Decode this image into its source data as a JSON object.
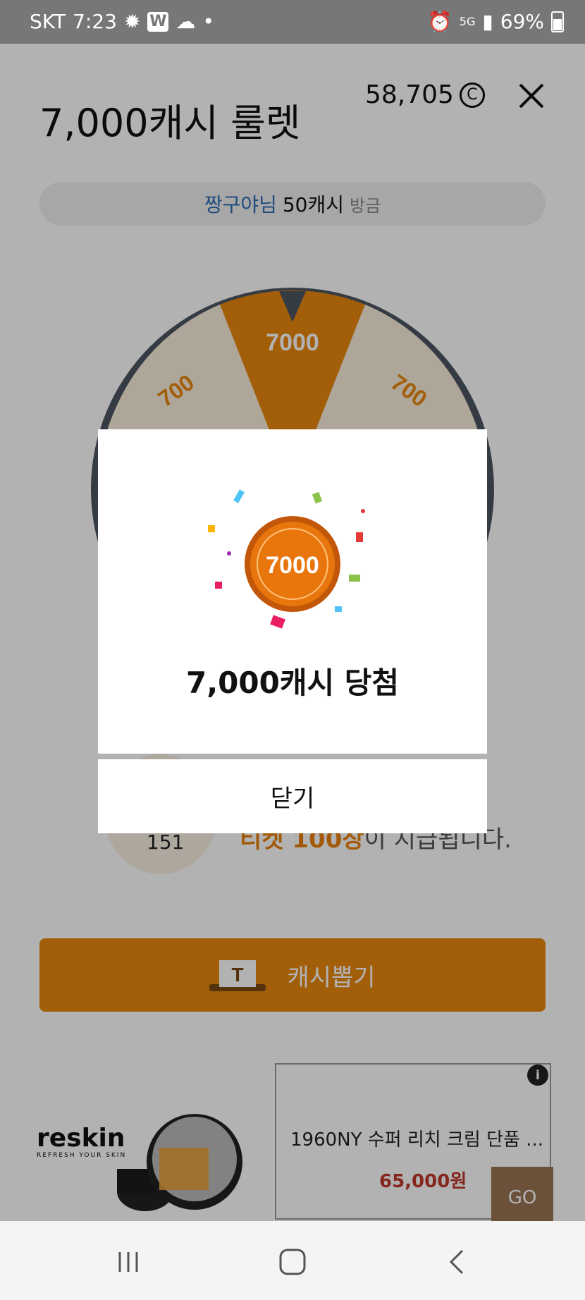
{
  "status_bar": {
    "carrier": "SKT",
    "time": "7:23",
    "network": "5G",
    "battery": "69%"
  },
  "header": {
    "title": "7,000캐시 룰렛",
    "cash_balance": "58,705",
    "cash_symbol": "C"
  },
  "notice": {
    "user": "짱구야님",
    "amount": "50캐시",
    "time": "방금"
  },
  "wheel": {
    "segments": [
      "700",
      "7000",
      "700"
    ],
    "accent_color": "#e8870d"
  },
  "tickets": {
    "count": "151",
    "text_highlight": "티켓 100장",
    "text_rest": "이 지급됩니다."
  },
  "draw_button": {
    "label": "캐시뽑기"
  },
  "ad": {
    "brand": "reskin",
    "brand_sub": "REFRESH YOUR SKIN",
    "product_title": "1960NY  수퍼 리치 크림  단품 ...",
    "price": "65,000원",
    "go_label": "GO",
    "info": "i"
  },
  "modal": {
    "coin_value": "7000",
    "result_text": "7,000캐시 당첨",
    "close_label": "닫기"
  }
}
